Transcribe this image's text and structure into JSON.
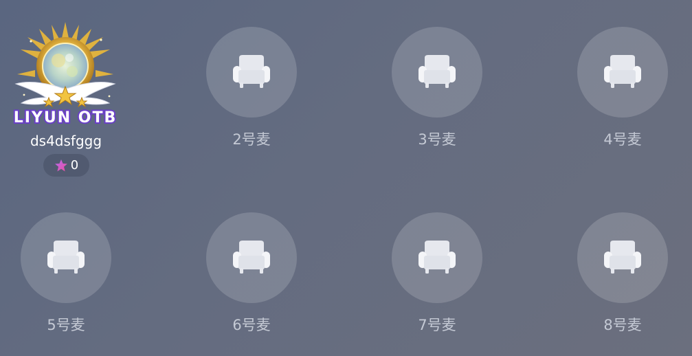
{
  "host": {
    "frame_text": "LIYUN OTB",
    "name": "ds4dsfggg",
    "charm_value": "0"
  },
  "seats": [
    {
      "label": "2号麦",
      "icon": "armchair-icon"
    },
    {
      "label": "3号麦",
      "icon": "armchair-icon"
    },
    {
      "label": "4号麦",
      "icon": "armchair-icon"
    },
    {
      "label": "5号麦",
      "icon": "armchair-icon"
    },
    {
      "label": "6号麦",
      "icon": "armchair-icon"
    },
    {
      "label": "7号麦",
      "icon": "armchair-icon"
    },
    {
      "label": "8号麦",
      "icon": "armchair-icon"
    }
  ],
  "colors": {
    "background": "#5f6880",
    "seat_circle": "rgba(255,255,255,0.16)",
    "seat_label": "#c4c9d4",
    "star": "#e84fb0",
    "frame_text": "#6a3fc8"
  }
}
